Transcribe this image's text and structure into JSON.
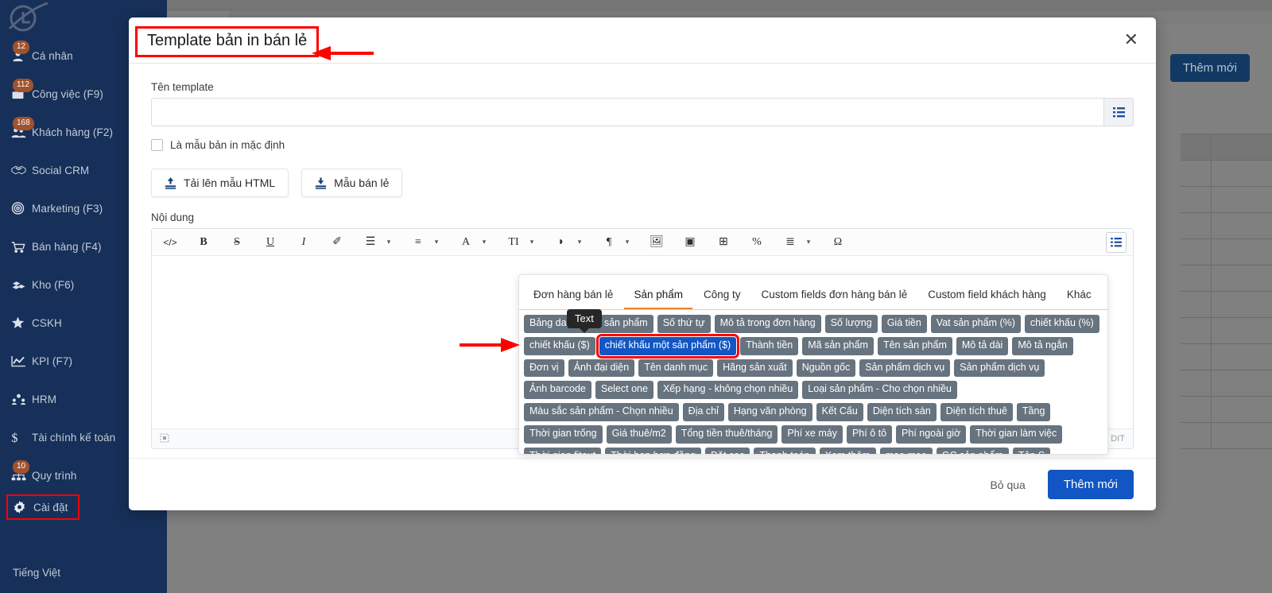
{
  "sidebar": {
    "logo": "satellite-logo",
    "language": "Tiếng Việt",
    "items": [
      {
        "label": "Cá nhân",
        "icon": "person-icon",
        "badge": "12"
      },
      {
        "label": "Công việc (F9)",
        "icon": "briefcase-icon",
        "badge": "112"
      },
      {
        "label": "Khách hàng (F2)",
        "icon": "people-icon",
        "badge": "168"
      },
      {
        "label": "Social CRM",
        "icon": "handshake-icon",
        "badge": ""
      },
      {
        "label": "Marketing (F3)",
        "icon": "target-icon",
        "badge": ""
      },
      {
        "label": "Bán hàng (F4)",
        "icon": "cart-icon",
        "badge": ""
      },
      {
        "label": "Kho (F6)",
        "icon": "boxes-icon",
        "badge": ""
      },
      {
        "label": "CSKH",
        "icon": "star-icon",
        "badge": ""
      },
      {
        "label": "KPI (F7)",
        "icon": "chart-line-icon",
        "badge": ""
      },
      {
        "label": "HRM",
        "icon": "org-people-icon",
        "badge": ""
      },
      {
        "label": "Tài chính kế toán",
        "icon": "dollar-icon",
        "badge": ""
      },
      {
        "label": "Quy trình",
        "icon": "sitemap-icon",
        "badge": "10"
      },
      {
        "label": "Cài đặt",
        "icon": "gear-icon",
        "badge": "",
        "highlighted": true
      }
    ]
  },
  "background": {
    "add_button": "Thêm mới"
  },
  "modal": {
    "title": "Template bản in bán lẻ",
    "close_icon": "close-icon",
    "name_field": {
      "label": "Tên template",
      "value": "",
      "placeholder": "",
      "addon_icon": "list-icon"
    },
    "checkbox": {
      "label": "Là mẫu bản in mặc định",
      "checked": false
    },
    "actions": [
      {
        "label": "Tải lên mẫu HTML",
        "icon": "upload-icon"
      },
      {
        "label": "Mẫu bán lẻ",
        "icon": "download-icon"
      }
    ],
    "content_label": "Nội dung",
    "editor": {
      "toolbar": [
        {
          "name": "source-code-icon",
          "glyph": "</>"
        },
        {
          "name": "bold-icon",
          "glyph": "B"
        },
        {
          "name": "strikethrough-icon",
          "glyph": "S"
        },
        {
          "name": "underline-icon",
          "glyph": "U"
        },
        {
          "name": "italic-icon",
          "glyph": "I"
        },
        {
          "name": "clear-format-icon",
          "glyph": "✐"
        },
        {
          "name": "bullet-list-icon",
          "glyph": "☰"
        },
        {
          "name": "numbered-list-icon",
          "glyph": "≡"
        },
        {
          "name": "font-family-icon",
          "glyph": "A"
        },
        {
          "name": "font-size-icon",
          "glyph": "TI"
        },
        {
          "name": "text-color-icon",
          "glyph": "◗"
        },
        {
          "name": "paragraph-icon",
          "glyph": "¶"
        },
        {
          "name": "image-icon",
          "glyph": "🖼"
        },
        {
          "name": "video-icon",
          "glyph": "▣"
        },
        {
          "name": "table-icon",
          "glyph": "⊞"
        },
        {
          "name": "link-icon",
          "glyph": "%"
        },
        {
          "name": "align-icon",
          "glyph": "≣"
        },
        {
          "name": "special-char-icon",
          "glyph": "Ω"
        }
      ],
      "expand_icon": "list-icon",
      "status_left_icon": "resize-icon",
      "status_right": "DIT",
      "body_text": ""
    },
    "footer": {
      "cancel": "Bỏ qua",
      "submit": "Thêm mới"
    }
  },
  "tag_panel": {
    "tooltip": "Text",
    "tabs": [
      {
        "label": "Đơn hàng bán lẻ",
        "active": false
      },
      {
        "label": "Sản phẩm",
        "active": true
      },
      {
        "label": "Công ty",
        "active": false
      },
      {
        "label": "Custom fields đơn hàng bán lẻ",
        "active": false
      },
      {
        "label": "Custom field khách hàng",
        "active": false
      },
      {
        "label": "Khác",
        "active": false
      }
    ],
    "chips": [
      {
        "label": "Bảng danh sách sản phẩm"
      },
      {
        "label": "Số thứ tự"
      },
      {
        "label": "Mô tả trong đơn hàng"
      },
      {
        "label": "Số lượng"
      },
      {
        "label": "Giá tiền"
      },
      {
        "label": "Vat sản phẩm (%)"
      },
      {
        "label": "chiết khấu (%)"
      },
      {
        "label": "chiết khấu ($)"
      },
      {
        "label": "chiết khấu một sản phẩm ($)",
        "selected": true
      },
      {
        "label": "Thành tiền"
      },
      {
        "label": "Mã sản phẩm"
      },
      {
        "label": "Tên sản phẩm"
      },
      {
        "label": "Mô tả dài"
      },
      {
        "label": "Mô tả ngắn"
      },
      {
        "label": "Đơn vị"
      },
      {
        "label": "Ảnh đại diện"
      },
      {
        "label": "Tên danh mục"
      },
      {
        "label": "Hãng sản xuất"
      },
      {
        "label": "Nguồn gốc"
      },
      {
        "label": "Sản phẩm dịch vụ"
      },
      {
        "label": "Sản phẩm dịch vụ"
      },
      {
        "label": "Ảnh barcode"
      },
      {
        "label": "Select one"
      },
      {
        "label": "Xếp hạng - không chọn nhiều"
      },
      {
        "label": "Loại sản phẩm - Cho chọn nhiều"
      },
      {
        "label": "Màu sắc sản phẩm - Chọn nhiều"
      },
      {
        "label": "Địa chỉ"
      },
      {
        "label": "Hạng văn phòng"
      },
      {
        "label": "Kết Cấu"
      },
      {
        "label": "Diện tích sàn"
      },
      {
        "label": "Diện tích thuê"
      },
      {
        "label": "Tầng"
      },
      {
        "label": "Thời gian trống"
      },
      {
        "label": "Giá thuê/m2"
      },
      {
        "label": "Tổng tiền thuê/tháng"
      },
      {
        "label": "Phí xe máy"
      },
      {
        "label": "Phí ô tô"
      },
      {
        "label": "Phí ngoài giờ"
      },
      {
        "label": "Thời gian làm việc"
      },
      {
        "label": "Thời gian fitout"
      },
      {
        "label": "Thời hạn hợp đồng"
      },
      {
        "label": "Đặt cọc"
      },
      {
        "label": "Thanh toán"
      },
      {
        "label": "Xem thêm"
      },
      {
        "label": "meo meo"
      },
      {
        "label": "GC sản phẩm"
      },
      {
        "label": "Tên S"
      }
    ]
  },
  "colors": {
    "sidebar_bg": "#173059",
    "badge": "#a0522d",
    "primary": "#1156c4",
    "bg_button": "#123963",
    "annotation_red": "#ff0000",
    "chip_bg": "#67737e",
    "tab_accent": "#ef8127"
  }
}
